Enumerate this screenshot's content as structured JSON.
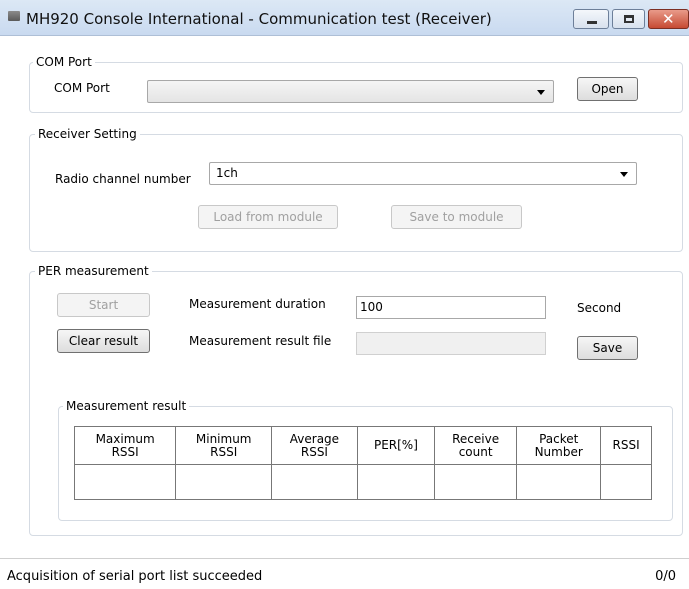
{
  "window": {
    "title": "MH920 Console International -  Communication test (Receiver)",
    "close_glyph": "✕"
  },
  "com_port": {
    "group_title": "COM Port",
    "label": "COM Port",
    "selected": "",
    "open_button": "Open"
  },
  "receiver": {
    "group_title": "Receiver Setting",
    "channel_label": "Radio channel number",
    "channel_value": "1ch",
    "load_button": "Load from module",
    "save_button": "Save to module"
  },
  "per": {
    "group_title": "PER measurement",
    "start_button": "Start",
    "clear_button": "Clear result",
    "duration_label": "Measurement duration",
    "duration_value": "100",
    "duration_unit": "Second",
    "result_file_label": "Measurement result file",
    "result_file_value": "",
    "save_button": "Save"
  },
  "result": {
    "group_title": "Measurement result",
    "columns": [
      [
        "Maximum",
        "RSSI"
      ],
      [
        "Minimum",
        "RSSI"
      ],
      [
        "Average",
        "RSSI"
      ],
      [
        "PER[%]",
        ""
      ],
      [
        "Receive",
        "count"
      ],
      [
        "Packet",
        "Number"
      ],
      [
        "RSSI",
        ""
      ]
    ],
    "row": [
      "",
      "",
      "",
      "",
      "",
      "",
      ""
    ]
  },
  "status": {
    "message": "Acquisition of serial port list succeeded",
    "count": "0/0"
  }
}
